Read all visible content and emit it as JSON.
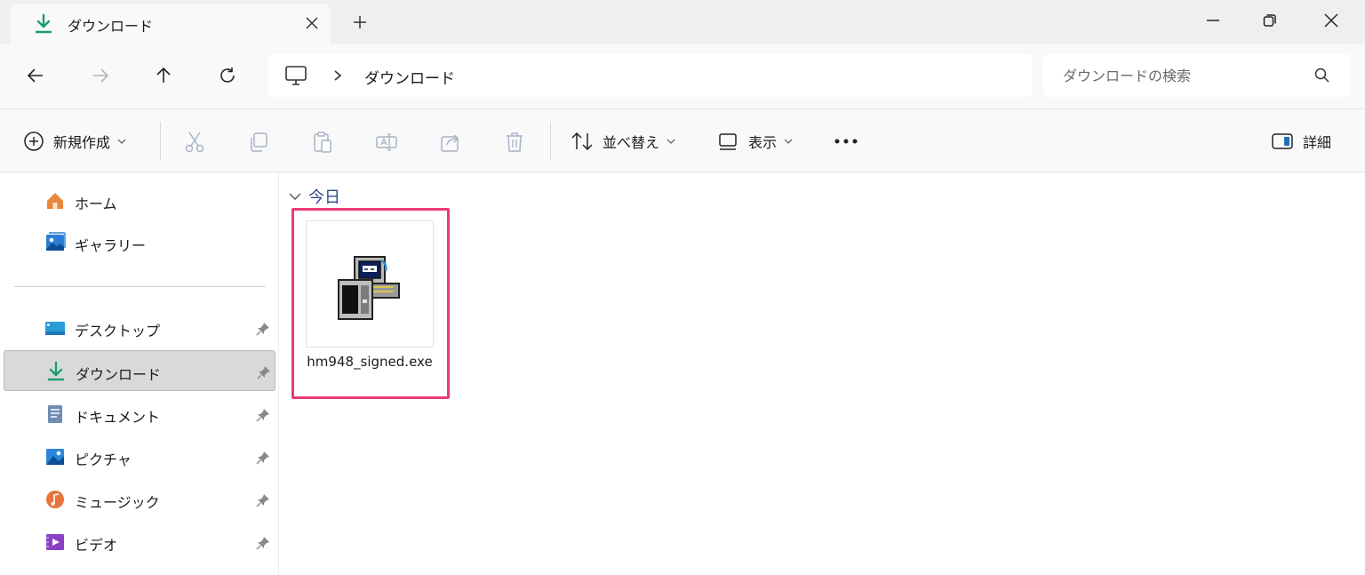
{
  "tab": {
    "title": "ダウンロード"
  },
  "window": {
    "new_tab": "+"
  },
  "address": {
    "location": "ダウンロード"
  },
  "search": {
    "placeholder": "ダウンロードの検索"
  },
  "toolbar": {
    "new_label": "新規作成",
    "sort_label": "並べ替え",
    "view_label": "表示",
    "details_label": "詳細"
  },
  "sidebar": {
    "items": [
      {
        "label": "ホーム",
        "icon": "home-icon",
        "pinned": false
      },
      {
        "label": "ギャラリー",
        "icon": "gallery-icon",
        "pinned": false
      },
      {
        "label": "デスクトップ",
        "icon": "desktop-icon",
        "pinned": true
      },
      {
        "label": "ダウンロード",
        "icon": "download-icon",
        "pinned": true,
        "selected": true
      },
      {
        "label": "ドキュメント",
        "icon": "document-icon",
        "pinned": true
      },
      {
        "label": "ピクチャ",
        "icon": "pictures-icon",
        "pinned": true
      },
      {
        "label": "ミュージック",
        "icon": "music-icon",
        "pinned": true
      },
      {
        "label": "ビデオ",
        "icon": "video-icon",
        "pinned": true
      }
    ]
  },
  "content": {
    "group": "今日",
    "files": [
      {
        "name": "hm948_signed.exe",
        "icon": "installer-icon"
      }
    ]
  },
  "colors": {
    "highlight": "#ea3b78",
    "download_green": "#1a9e6b",
    "group_header": "#2f4a8a"
  }
}
